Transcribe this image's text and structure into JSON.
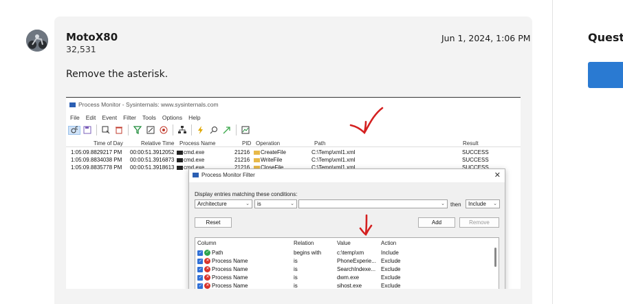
{
  "post": {
    "username": "MotoX80",
    "points": "32,531",
    "date": "Jun 1, 2024, 1:06 PM",
    "body": "Remove the asterisk."
  },
  "sidebar": {
    "heading": "Quest",
    "button_color": "#2a7ad2"
  },
  "screenshot": {
    "window_title": "Process Monitor - Sysinternals: www.sysinternals.com",
    "menu": [
      "File",
      "Edit",
      "Event",
      "Filter",
      "Tools",
      "Options",
      "Help"
    ],
    "columns": [
      "Time of Day",
      "Relative Time",
      "Process Name",
      "PID",
      "Operation",
      "Path",
      "Result"
    ],
    "rows": [
      [
        "1:05:09.8829217 PM",
        "00:00:51.3912052",
        "cmd.exe",
        "21216",
        "CreateFile",
        "C:\\Temp\\xml1.xml",
        "SUCCESS"
      ],
      [
        "1:05:09.8834038 PM",
        "00:00:51.3916873",
        "cmd.exe",
        "21216",
        "WriteFile",
        "C:\\Temp\\xml1.xml",
        "SUCCESS"
      ],
      [
        "1:05:09.8835778 PM",
        "00:00:51.3918613",
        "cmd.exe",
        "21216",
        "CloseFile",
        "C:\\Temp\\xml1.xml",
        "SUCCESS"
      ]
    ],
    "filter": {
      "title": "Process Monitor Filter",
      "conditions_label": "Display entries matching these conditions:",
      "column_select": "Architecture",
      "relation_select": "is",
      "value_select": "",
      "then_label": "then",
      "action_select": "Include",
      "reset_label": "Reset",
      "add_label": "Add",
      "remove_label": "Remove",
      "grid_headers": [
        "Column",
        "Relation",
        "Value",
        "Action"
      ],
      "grid_rows": [
        {
          "column": "Path",
          "relation": "begins with",
          "value": "c:\\temp\\xm",
          "action": "Include",
          "kind": "include"
        },
        {
          "column": "Process Name",
          "relation": "is",
          "value": "PhoneExperie...",
          "action": "Exclude",
          "kind": "exclude"
        },
        {
          "column": "Process Name",
          "relation": "is",
          "value": "SearchIndexe...",
          "action": "Exclude",
          "kind": "exclude"
        },
        {
          "column": "Process Name",
          "relation": "is",
          "value": "dwm.exe",
          "action": "Exclude",
          "kind": "exclude"
        },
        {
          "column": "Process Name",
          "relation": "is",
          "value": "sihost.exe",
          "action": "Exclude",
          "kind": "exclude"
        }
      ]
    },
    "annotation_color": "#d42020"
  }
}
